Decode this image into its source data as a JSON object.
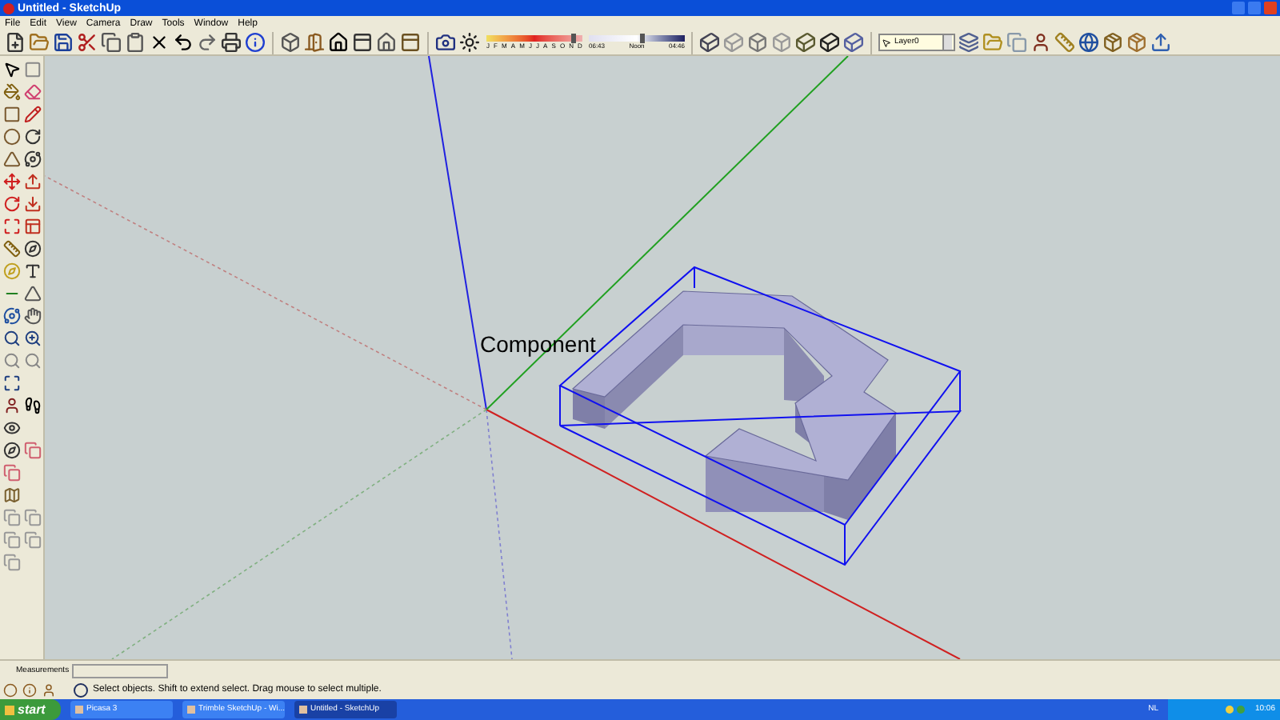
{
  "window": {
    "title": "Untitled - SketchUp"
  },
  "menu": [
    "File",
    "Edit",
    "View",
    "Camera",
    "Draw",
    "Tools",
    "Window",
    "Help"
  ],
  "shadow": {
    "months": [
      "J",
      "F",
      "M",
      "A",
      "M",
      "J",
      "J",
      "A",
      "S",
      "O",
      "N",
      "D"
    ],
    "date_slider": {
      "level": 0.9
    },
    "time_start": "06:43",
    "time_mid": "Noon",
    "time_end": "04:46",
    "time_slider": {
      "level": 0.55
    }
  },
  "layer": {
    "value": "Layer0"
  },
  "canvas": {
    "label": "Component"
  },
  "measurements": {
    "label": "Measurements"
  },
  "status_bar": {
    "message": "Select objects. Shift to extend select. Drag mouse to select multiple."
  },
  "taskbar": {
    "start": "start",
    "tasks": [
      {
        "label": "Picasa 3",
        "selected": false
      },
      {
        "label": "Trimble SketchUp - Wi...",
        "selected": false
      },
      {
        "label": "Untitled - SketchUp",
        "selected": true
      }
    ],
    "language": "NL",
    "clock": "10:06"
  }
}
